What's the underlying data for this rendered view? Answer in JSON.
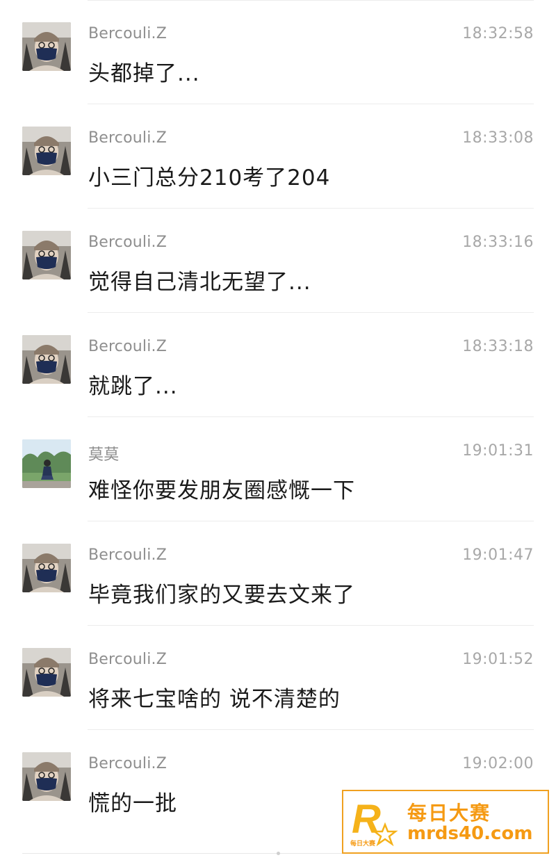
{
  "messages": [
    {
      "sender": "Bercouli.Z",
      "time": "18:32:58",
      "text": "头都掉了...",
      "avatar": "masked-man-avatar"
    },
    {
      "sender": "Bercouli.Z",
      "time": "18:33:08",
      "text": "小三门总分210考了204",
      "avatar": "masked-man-avatar"
    },
    {
      "sender": "Bercouli.Z",
      "time": "18:33:16",
      "text": "觉得自己清北无望了...",
      "avatar": "masked-man-avatar"
    },
    {
      "sender": "Bercouli.Z",
      "time": "18:33:18",
      "text": "就跳了...",
      "avatar": "masked-man-avatar"
    },
    {
      "sender": "莫莫",
      "time": "19:01:31",
      "text": "难怪你要发朋友圈感慨一下",
      "avatar": "girl-outdoor-avatar"
    },
    {
      "sender": "Bercouli.Z",
      "time": "19:01:47",
      "text": "毕竟我们家的又要去文来了",
      "avatar": "masked-man-avatar"
    },
    {
      "sender": "Bercouli.Z",
      "time": "19:01:52",
      "text": "将来七宝啥的 说不清楚的",
      "avatar": "masked-man-avatar"
    },
    {
      "sender": "Bercouli.Z",
      "time": "19:02:00",
      "text": "慌的一批",
      "avatar": "masked-man-avatar"
    }
  ],
  "watermark": {
    "title": "每日大赛",
    "url": "mrds40.com",
    "logo_letter": "R",
    "logo_caption": "每日大赛",
    "color": "#f59a13"
  }
}
